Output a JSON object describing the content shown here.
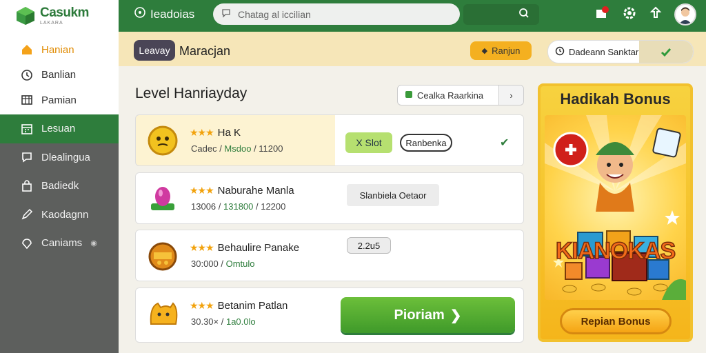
{
  "app": {
    "logo_title": "Casukm",
    "logo_sub": "LAKARA"
  },
  "sidebar": {
    "items": [
      {
        "label": "Hanian",
        "icon": "home-icon"
      },
      {
        "label": "Banlian",
        "icon": "clock-icon"
      },
      {
        "label": "Pamian",
        "icon": "grid-icon"
      },
      {
        "label": "Lesuan",
        "icon": "calendar-icon"
      },
      {
        "label": "Dlealingua",
        "icon": "chat-icon"
      },
      {
        "label": "Badiedk",
        "icon": "bag-icon"
      },
      {
        "label": "Kaodagnn",
        "icon": "pen-icon"
      },
      {
        "label": "Caniams",
        "icon": "location-icon"
      }
    ]
  },
  "header": {
    "brand": "Ieadoias",
    "search_placeholder": "Chatag al iccilian"
  },
  "banner": {
    "pill": "Leavay",
    "title": "Maracjan",
    "orange_button": "Ranjun",
    "white_pill": "Dadeann Sanktar"
  },
  "main": {
    "title": "Level Hanriayday",
    "filter_label": "Cealka Raarkina",
    "cards": [
      {
        "name": "Ha K",
        "meta_a": "Cadec / ",
        "meta_g": "Msdoo",
        "meta_b": " / 11200",
        "tag1": "X Slot",
        "tag2": "Ranbenka"
      },
      {
        "name": "Naburahe Manla",
        "meta_a": "13006 / ",
        "meta_g": "131800",
        "meta_b": " / 12200",
        "tag1": "Slanbiela Oetaor"
      },
      {
        "name": "Behaulire Panake",
        "meta_a": "30:000 / ",
        "meta_g": "Omtulo",
        "meta_b": "",
        "tag1": "2.2u5"
      },
      {
        "name": "Betanim Patlan",
        "meta_a": "30.30× / ",
        "meta_g": "1a0.0lo",
        "meta_b": "",
        "button": "Pioriam"
      }
    ]
  },
  "bonus": {
    "title": "Hadikah Bonus",
    "art_word": "KIANOKAS",
    "button": "Repian Bonus"
  },
  "colors": {
    "primary_green": "#2e7d3c",
    "accent_orange": "#f4b020",
    "sidebar_dark": "#5d5f5d"
  }
}
